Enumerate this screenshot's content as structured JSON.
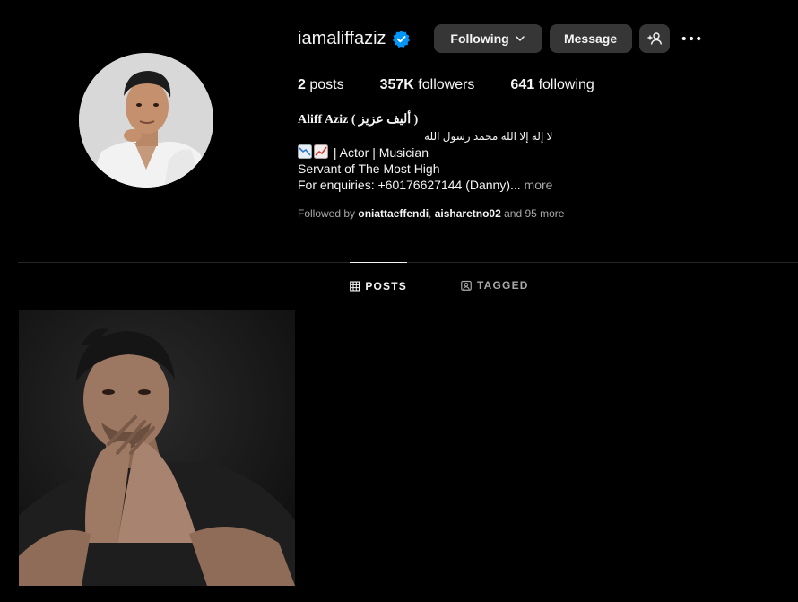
{
  "profile": {
    "username": "iamaliffaziz",
    "verified": true,
    "buttons": {
      "following": "Following",
      "message": "Message"
    },
    "stats": {
      "posts_count": "2",
      "posts_label": " posts",
      "followers_count": "357K",
      "followers_label": " followers",
      "following_count": "641",
      "following_label": " following"
    },
    "bio": {
      "name": "Aliff Aziz ( أليف عزيز )",
      "arabic_line": "لا إله إلا الله محمد رسول الله",
      "roles": "| Actor | Musician",
      "line3": "Servant of The Most High",
      "line4": "For enquiries: +60176627144 (Danny)...",
      "more": " more"
    },
    "followed_by": {
      "prefix": "Followed by ",
      "accounts": [
        "oniattaeffendi",
        "aisharetno02"
      ],
      "separator": ", ",
      "suffix": " and 95 more"
    }
  },
  "tabs": [
    {
      "label": "POSTS",
      "active": true
    },
    {
      "label": "TAGGED",
      "active": false
    }
  ],
  "colors": {
    "background": "#000000",
    "button": "#363636",
    "verified": "#0095f6",
    "muted": "#a8a8a8"
  },
  "icons": [
    "verified-badge-icon",
    "chevron-down-icon",
    "add-person-icon",
    "more-options-icon",
    "grid-icon",
    "tagged-icon",
    "chart-down-emoji-icon",
    "chart-up-emoji-icon"
  ]
}
